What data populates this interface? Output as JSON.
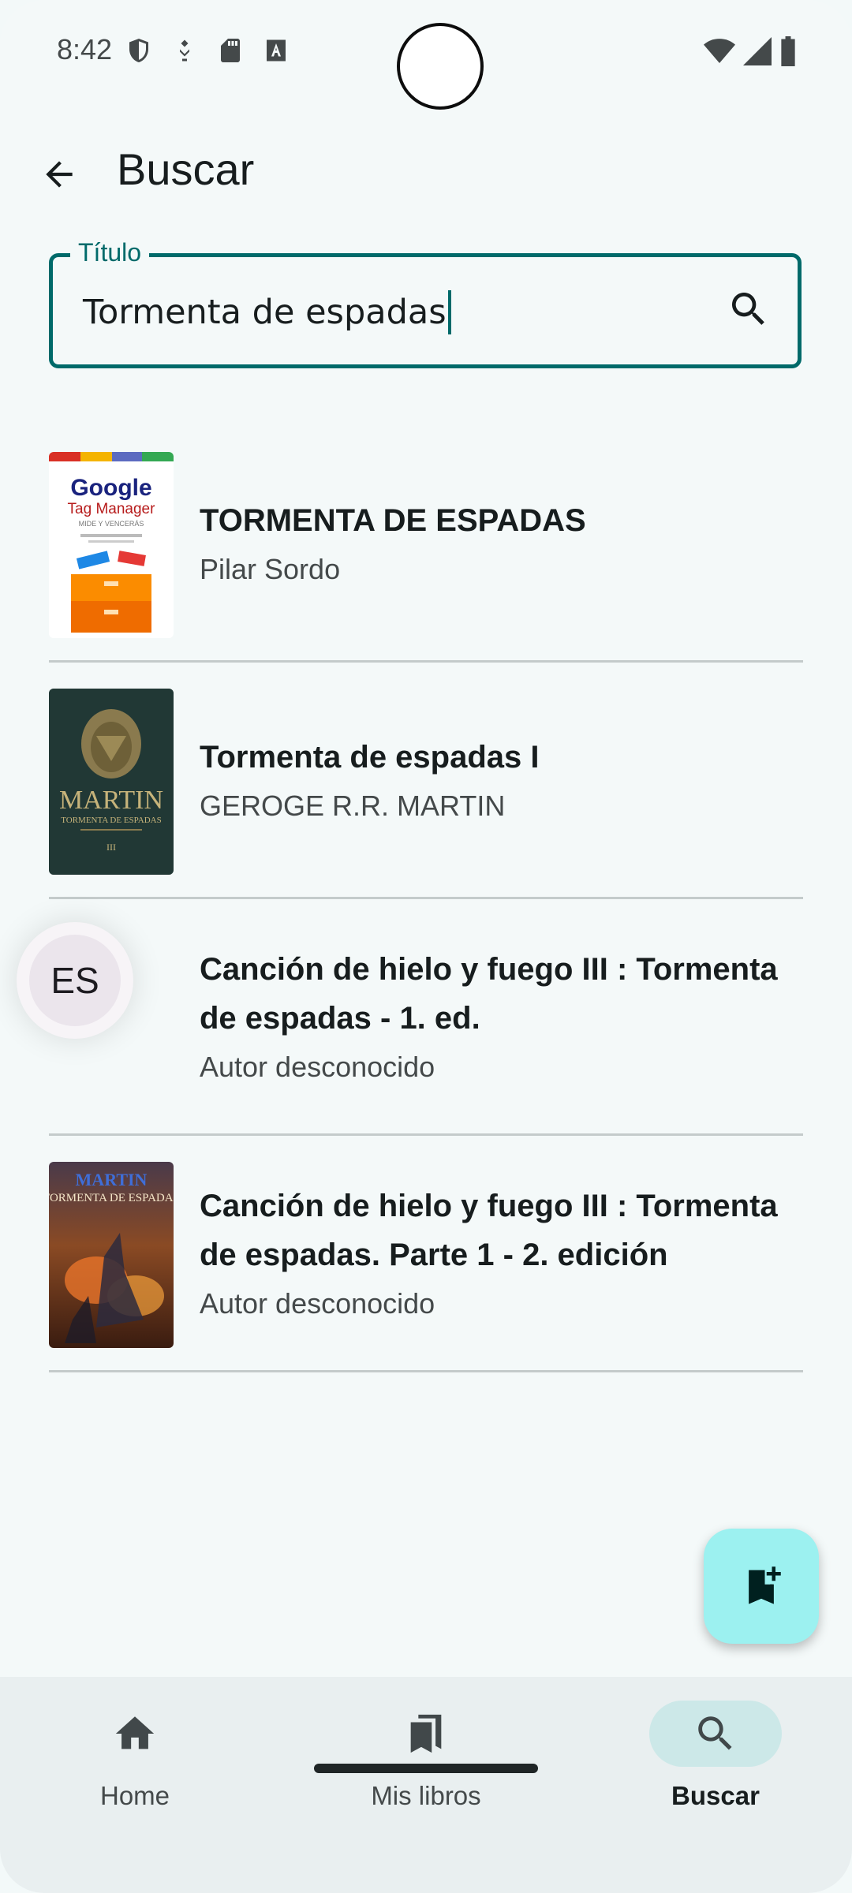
{
  "status_bar": {
    "time": "8:42",
    "left_icons": [
      "shield-icon",
      "vpn-key-icon",
      "sd-card-icon",
      "text-a-icon"
    ],
    "right_icons": [
      "wifi-icon",
      "cell-signal-icon",
      "battery-icon"
    ]
  },
  "app_bar": {
    "title": "Buscar",
    "back_icon": "arrow-back-icon"
  },
  "search": {
    "label": "Título",
    "value": "Tormenta de espadas",
    "icon": "search-icon",
    "accent": "#006a6a"
  },
  "results": [
    {
      "title": "TORMENTA DE ESPADAS",
      "author": "Pilar Sordo",
      "cover": {
        "kind": "google",
        "brand_top": "Google",
        "brand_bottom": "Tag Manager",
        "tagline": "MIDE Y VENCERÁS"
      }
    },
    {
      "title": "Tormenta de espadas I",
      "author": "GEROGE R.R. MARTIN",
      "cover": {
        "kind": "martin-dark",
        "author_line": "MARTIN",
        "subtitle": "TORMENTA DE ESPADAS"
      }
    },
    {
      "title": "Canción de hielo y fuego III : Tormenta de espadas - 1. ed.",
      "author": "Autor desconocido",
      "cover": {
        "kind": "none"
      }
    },
    {
      "title": "Canción de hielo y fuego III : Tormenta de espadas. Parte 1 - 2. edición",
      "author": "Autor desconocido",
      "cover": {
        "kind": "martin-fire",
        "author_line": "MARTIN",
        "subtitle": "TORMENTA DE ESPADAS"
      }
    }
  ],
  "language_bubble": {
    "code": "ES"
  },
  "fab": {
    "icon": "bookmark-add-icon",
    "color": "#9cf1f0"
  },
  "bottom_nav": {
    "items": [
      {
        "label": "Home",
        "icon": "home-icon",
        "active": false
      },
      {
        "label": "Mis libros",
        "icon": "books-icon",
        "active": false
      },
      {
        "label": "Buscar",
        "icon": "search-icon",
        "active": true
      }
    ]
  }
}
